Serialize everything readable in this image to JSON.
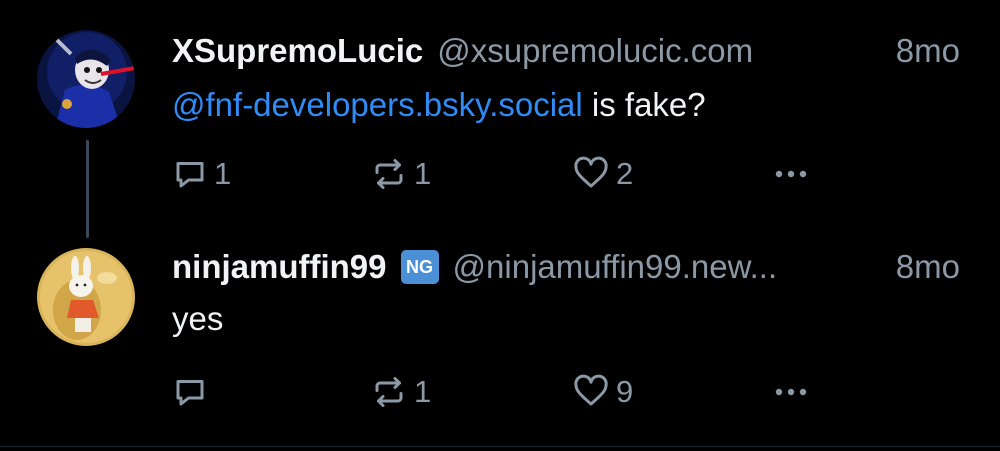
{
  "posts": [
    {
      "author": {
        "display_name": "XSupremoLucic",
        "handle": "@xsupremolucic.com",
        "avatar": "dark-blue-character-avatar"
      },
      "timestamp": "8mo",
      "text_mention": "@fnf-developers.bsky.social",
      "text_rest": " is fake?",
      "counts": {
        "replies": "1",
        "reposts": "1",
        "likes": "2"
      }
    },
    {
      "author": {
        "display_name": "ninjamuffin99",
        "badge": "NG",
        "handle": "@ninjamuffin99.new...",
        "avatar": "bunny-figurine-avatar"
      },
      "timestamp": "8mo",
      "text": "yes",
      "counts": {
        "replies": "",
        "reposts": "1",
        "likes": "9"
      }
    }
  ],
  "icons": {
    "reply": "reply-icon",
    "repost": "repost-icon",
    "like": "heart-icon",
    "more": "more-options-icon"
  },
  "colors": {
    "background": "#000000",
    "text": "#f1f3f5",
    "muted": "#8b98a5",
    "link": "#2f8cf5",
    "badge": "#4b8fd6"
  }
}
